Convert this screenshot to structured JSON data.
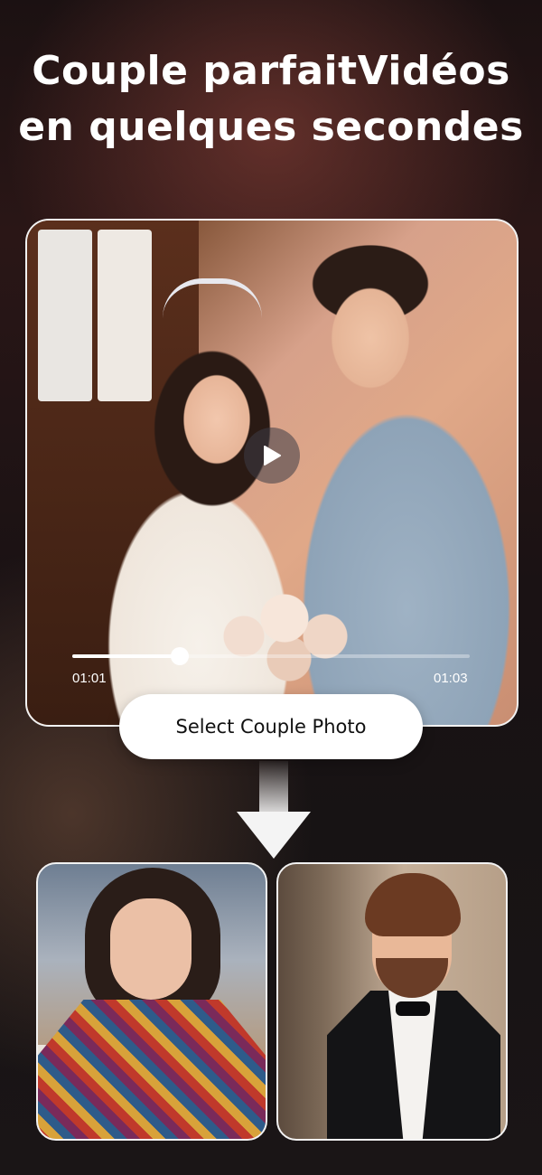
{
  "headline": {
    "line1": "Couple parfaitVidéos",
    "line2": "en quelques secondes"
  },
  "video_player": {
    "current_time": "01:01",
    "total_time": "01:03",
    "progress_fraction": 0.27
  },
  "select_button": {
    "label": "Select Couple Photo"
  },
  "icons": {
    "play": "play-icon",
    "arrow": "arrow-down-icon"
  },
  "colors": {
    "accent": "#ffffff",
    "pill_text": "#111111"
  }
}
